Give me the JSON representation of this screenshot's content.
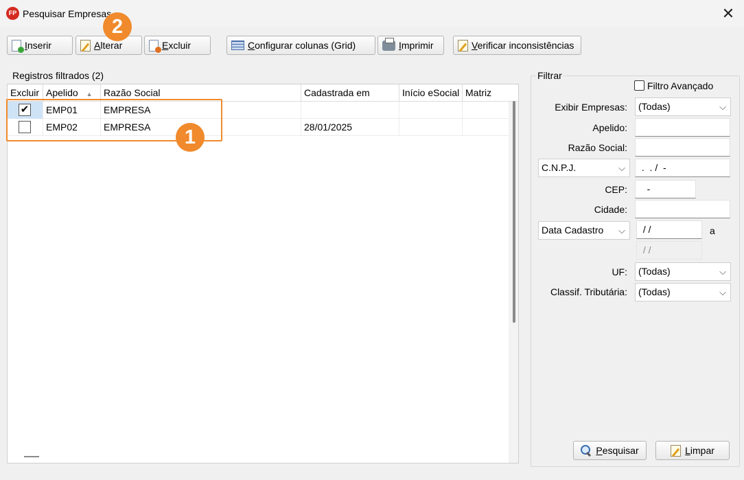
{
  "window": {
    "title": "Pesquisar Empresas",
    "logo_text": "FP",
    "close_glyph": "✕"
  },
  "toolbar": {
    "inserir": "Inserir",
    "alterar": "Alterar",
    "excluir": "Excluir",
    "configurar": "Configurar colunas (Grid)",
    "imprimir": "Imprimir",
    "verificar": "Verificar inconsistências"
  },
  "grid": {
    "group_title": "Registros filtrados (2)",
    "columns": [
      "Excluir",
      "Apelido",
      "Razão Social",
      "Cadastrada em",
      "Início eSocial",
      "Matriz"
    ],
    "sort_indicator": "▲",
    "rows": [
      {
        "checked": "✔",
        "apelido": "EMP01",
        "razao": "EMPRESA",
        "cadastrada": "",
        "inicio": "",
        "matriz": ""
      },
      {
        "checked": "",
        "apelido": "EMP02",
        "razao": "EMPRESA",
        "cadastrada": "28/01/2025",
        "inicio": "",
        "matriz": ""
      }
    ]
  },
  "markers": {
    "one": "1",
    "two": "2"
  },
  "filter": {
    "title": "Filtrar",
    "filtro_avancado": "Filtro Avançado",
    "exibir_empresas_label": "Exibir Empresas:",
    "exibir_empresas_value": "(Todas)",
    "apelido_label": "Apelido:",
    "razao_social_label": "Razão Social:",
    "cnpj_select": "C.N.P.J.",
    "cnpj_mask": " .  . /  -",
    "cep_label": "CEP:",
    "cep_mask": "   -",
    "cidade_label": "Cidade:",
    "data_select": "Data Cadastro",
    "data_from": " / /",
    "data_sep": "a",
    "data_to": " / /",
    "uf_label": "UF:",
    "uf_value": "(Todas)",
    "classif_label": "Classif. Tributária:",
    "classif_value": "(Todas)",
    "pesquisar": "Pesquisar",
    "limpar": "Limpar",
    "chevron": "⌵"
  }
}
